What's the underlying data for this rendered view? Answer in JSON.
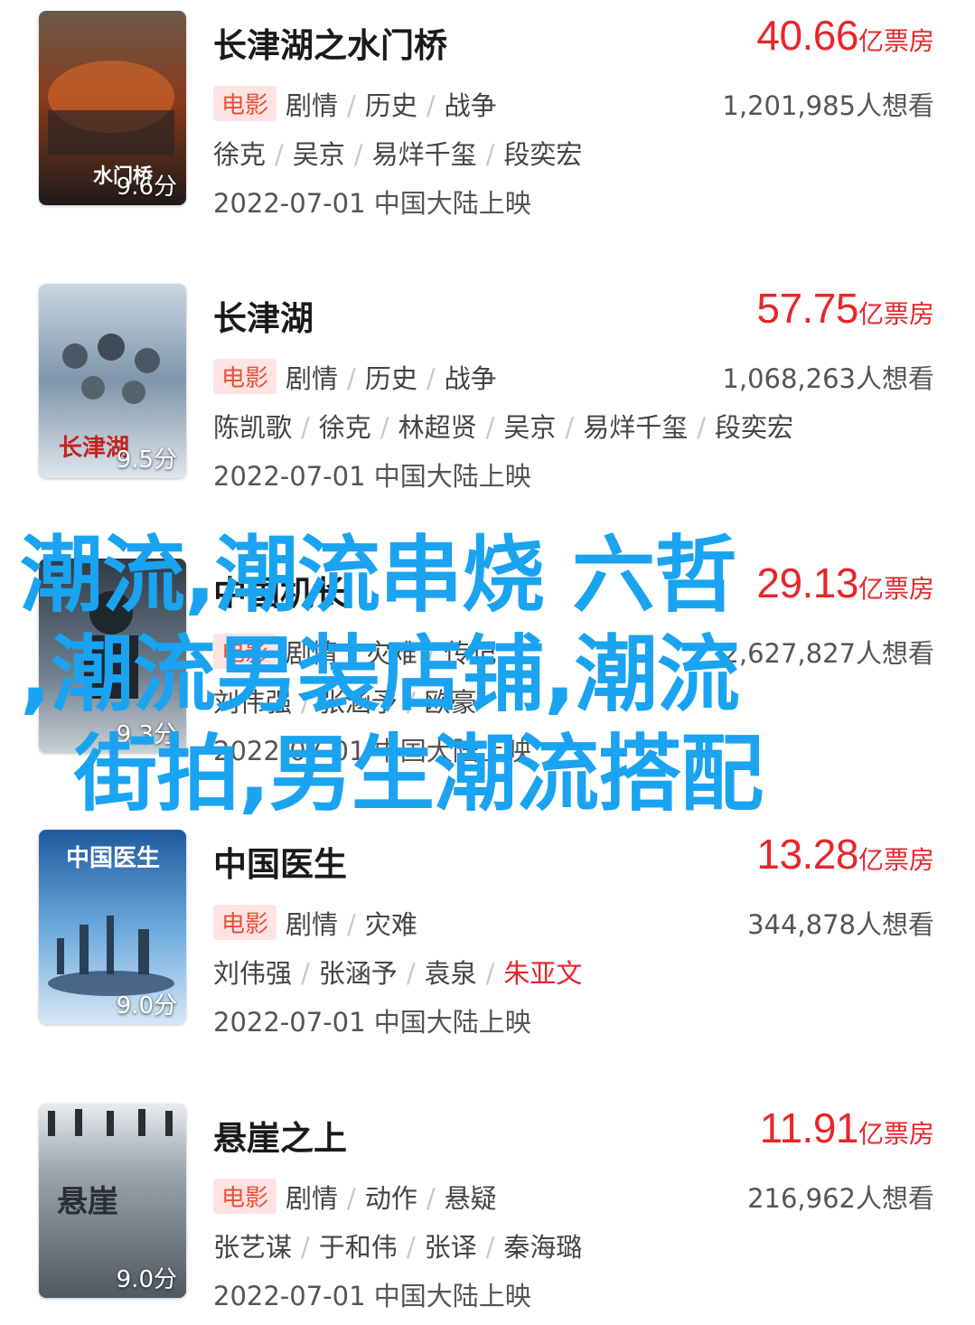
{
  "movies": [
    {
      "title": "长津湖之水门桥",
      "box_office": "40.66",
      "box_office_unit": "亿票房",
      "tag": "电影",
      "genres": [
        "剧情",
        "历史",
        "战争"
      ],
      "want": "1,201,985人想看",
      "cast": [
        "徐克",
        "吴京",
        "易烊千玺",
        "段奕宏"
      ],
      "release": "2022-07-01 中国大陆上映",
      "score": "9.6分",
      "poster_palette": [
        "#2a2a2a",
        "#c2421c",
        "#e88a3a"
      ]
    },
    {
      "title": "长津湖",
      "box_office": "57.75",
      "box_office_unit": "亿票房",
      "tag": "电影",
      "genres": [
        "剧情",
        "历史",
        "战争"
      ],
      "want": "1,068,263人想看",
      "cast": [
        "陈凯歌",
        "徐克",
        "林超贤",
        "吴京",
        "易烊千玺",
        "段奕宏"
      ],
      "release": "2022-07-01 中国大陆上映",
      "score": "9.5分",
      "poster_palette": [
        "#6d8aa6",
        "#a9bfd3",
        "#3a4a5a"
      ]
    },
    {
      "title": "中国机长",
      "box_office": "29.13",
      "box_office_unit": "亿票房",
      "tag": "电影",
      "genres": [
        "剧情",
        "灾难",
        "传记"
      ],
      "want": "2,627,827人想看",
      "cast": [
        "刘伟强",
        "张涵予",
        "欧豪"
      ],
      "release": "2022-07-01 中国大陆上映",
      "score": "9.3分",
      "poster_palette": [
        "#3b4652",
        "#8a99a8",
        "#d9d9d9"
      ]
    },
    {
      "title": "中国医生",
      "box_office": "13.28",
      "box_office_unit": "亿票房",
      "tag": "电影",
      "genres": [
        "剧情",
        "灾难"
      ],
      "want": "344,878人想看",
      "cast": [
        "刘伟强",
        "张涵予",
        "袁泉",
        "朱亚文"
      ],
      "release": "2022-07-01 中国大陆上映",
      "score": "9.0分",
      "poster_palette": [
        "#1c4e8a",
        "#5b9fd6",
        "#cfe3f5"
      ]
    },
    {
      "title": "悬崖之上",
      "box_office": "11.91",
      "box_office_unit": "亿票房",
      "tag": "电影",
      "genres": [
        "剧情",
        "动作",
        "悬疑"
      ],
      "want": "216,962人想看",
      "cast": [
        "张艺谋",
        "于和伟",
        "张译",
        "秦海璐"
      ],
      "release": "2022-07-01 中国大陆上映",
      "score": "9.0分",
      "poster_palette": [
        "#5c6670",
        "#9aa5ae",
        "#e6e8ea"
      ]
    }
  ],
  "overlay_text": [
    "潮流,潮流串烧 六哲",
    ",潮流男装店铺,潮流",
    "街拍,男生潮流搭配"
  ],
  "colors": {
    "accent_red": "#e8262a",
    "tag_bg": "#fde4e2",
    "overlay_blue": "#1aa3f0"
  }
}
